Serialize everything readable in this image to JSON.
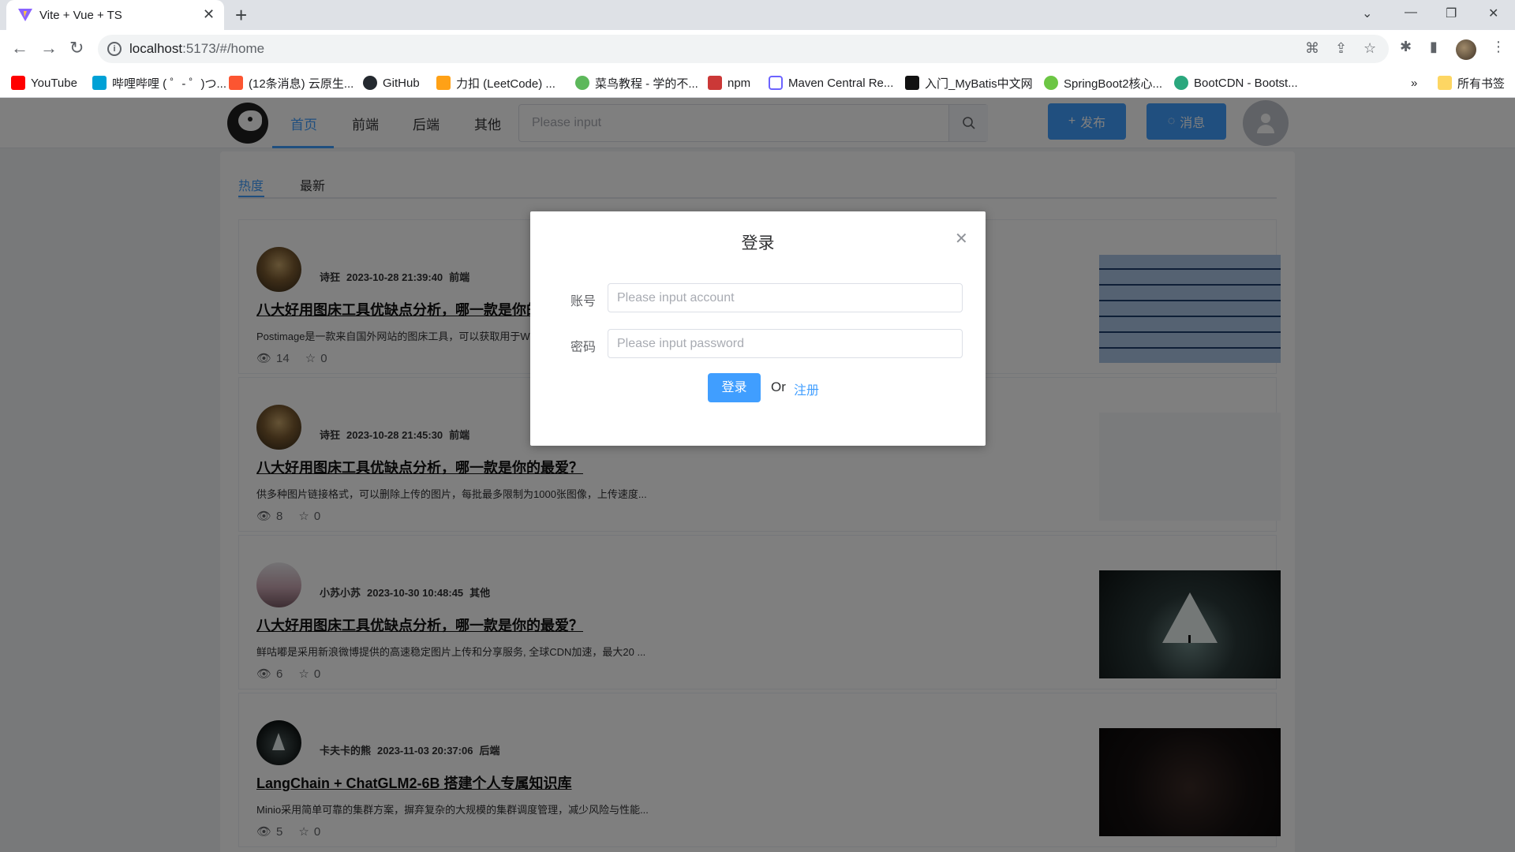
{
  "browser": {
    "tab_title": "Vite + Vue + TS",
    "url_host": "localhost",
    "url_rest": ":5173/#/home",
    "bookmarks": [
      {
        "label": "YouTube",
        "color": "#ff0000"
      },
      {
        "label": "哔哩哔哩 ( ゜- ゜)つ...",
        "color": "#00a1d6"
      },
      {
        "label": "(12条消息) 云原生...",
        "color": "#fc5531"
      },
      {
        "label": "GitHub",
        "color": "#24292f"
      },
      {
        "label": "力扣 (LeetCode) ...",
        "color": "#ffa116"
      },
      {
        "label": "菜鸟教程 - 学的不...",
        "color": "#5db85b"
      },
      {
        "label": "npm",
        "color": "#cb3837"
      },
      {
        "label": "Maven Central Re...",
        "color": "#6c63ff"
      },
      {
        "label": "入门_MyBatis中文网",
        "color": "#111111"
      },
      {
        "label": "SpringBoot2核心...",
        "color": "#6cc644"
      },
      {
        "label": "BootCDN - Bootst...",
        "color": "#2aa77d"
      }
    ],
    "bookmarks_more": "»",
    "all_bookmarks": "所有书签"
  },
  "nav": {
    "menu": [
      "首页",
      "前端",
      "后端",
      "其他"
    ],
    "search_placeholder": "Please input",
    "publish_label": "发布",
    "message_label": "消息"
  },
  "subtabs": [
    "热度",
    "最新"
  ],
  "articles": [
    {
      "author": "诗狂",
      "datetime": "2023-10-28 21:39:40",
      "category": "前端",
      "title": "八大好用图床工具优缺点分析，哪一款是你的最爱？",
      "desc": "Postimage是一款来自国外网站的图床工具，可以获取用于Web、博客、论坛等的多种图片链接格式...",
      "views": "14",
      "stars": "0"
    },
    {
      "author": "诗狂",
      "datetime": "2023-10-28 21:45:30",
      "category": "前端",
      "title": "八大好用图床工具优缺点分析，哪一款是你的最爱？",
      "desc": "供多种图片链接格式，可以删除上传的图片，每批最多限制为1000张图像，上传速度...",
      "views": "8",
      "stars": "0"
    },
    {
      "author": "小苏小苏",
      "datetime": "2023-10-30 10:48:45",
      "category": "其他",
      "title": "八大好用图床工具优缺点分析，哪一款是你的最爱？",
      "desc": "鲜咕嘟是采用新浪微博提供的高速稳定图片上传和分享服务, 全球CDN加速，最大20 ...",
      "views": "6",
      "stars": "0"
    },
    {
      "author": "卡夫卡的熊",
      "datetime": "2023-11-03 20:37:06",
      "category": "后端",
      "title": "LangChain + ChatGLM2-6B 搭建个人专属知识库",
      "desc": "Minio采用简单可靠的集群方案，摒弃复杂的大规模的集群调度管理，减少风险与性能...",
      "views": "5",
      "stars": "0"
    }
  ],
  "dialog": {
    "title": "登录",
    "account_label": "账号",
    "account_placeholder": "Please input account",
    "password_label": "密码",
    "password_placeholder": "Please input password",
    "login_button": "登录",
    "or_text": "Or",
    "register_link": "注册"
  }
}
